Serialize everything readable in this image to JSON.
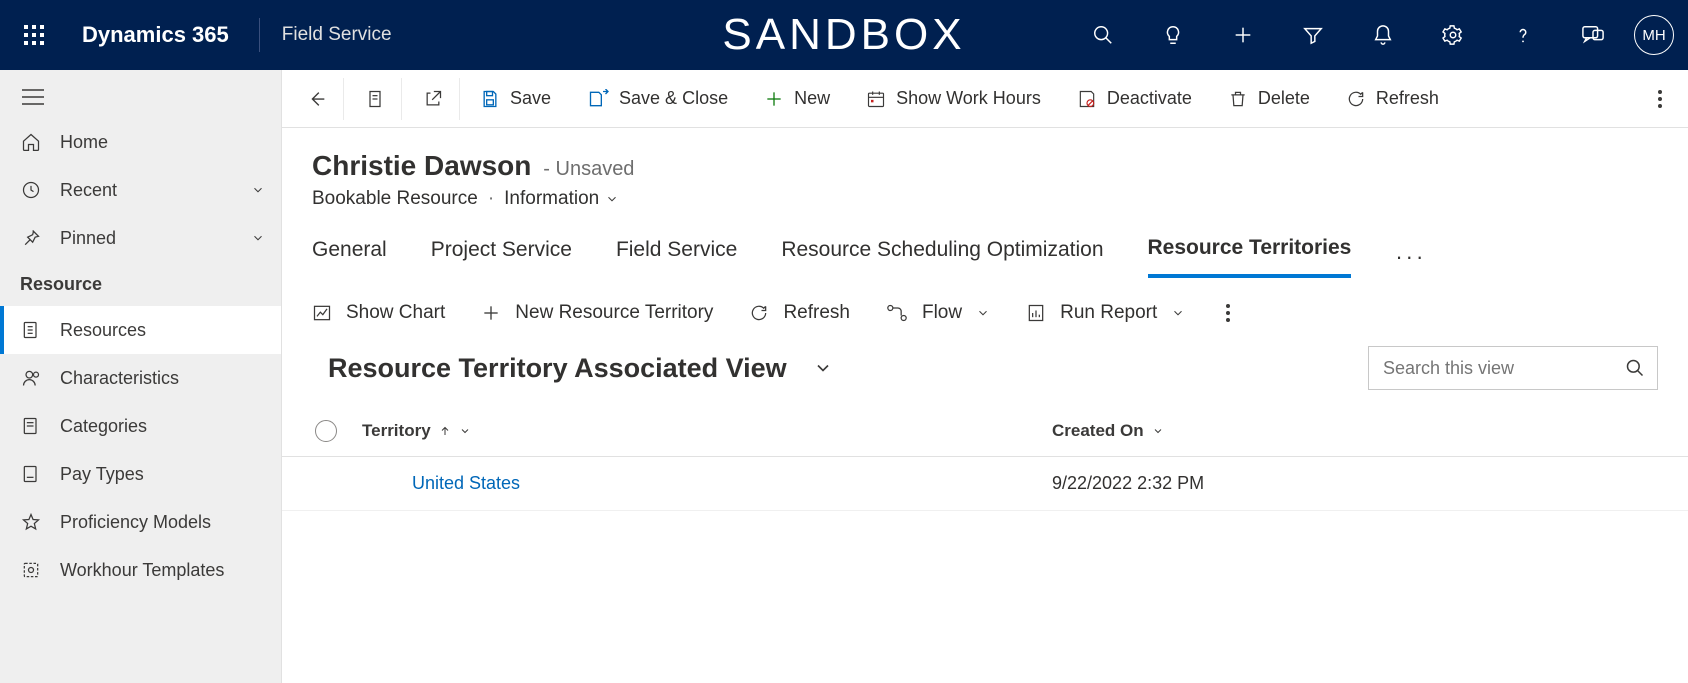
{
  "navbar": {
    "app": "Dynamics 365",
    "area": "Field Service",
    "sandbox": "SANDBOX",
    "avatar": "MH"
  },
  "sidebar": {
    "home": "Home",
    "recent": "Recent",
    "pinned": "Pinned",
    "group": "Resource",
    "items": [
      {
        "label": "Resources"
      },
      {
        "label": "Characteristics"
      },
      {
        "label": "Categories"
      },
      {
        "label": "Pay Types"
      },
      {
        "label": "Proficiency Models"
      },
      {
        "label": "Workhour Templates"
      }
    ]
  },
  "toolbar": {
    "save": "Save",
    "save_close": "Save & Close",
    "new": "New",
    "work_hours": "Show Work Hours",
    "deactivate": "Deactivate",
    "delete": "Delete",
    "refresh": "Refresh"
  },
  "header": {
    "title": "Christie Dawson",
    "unsaved": "- Unsaved",
    "entity": "Bookable Resource",
    "form": "Information"
  },
  "tabs": {
    "items": [
      {
        "label": "General"
      },
      {
        "label": "Project Service"
      },
      {
        "label": "Field Service"
      },
      {
        "label": "Resource Scheduling Optimization"
      },
      {
        "label": "Resource Territories"
      }
    ],
    "selected_index": 4
  },
  "sub_toolbar": {
    "show_chart": "Show Chart",
    "new_territory": "New Resource Territory",
    "refresh": "Refresh",
    "flow": "Flow",
    "report": "Run Report"
  },
  "view": {
    "title": "Resource Territory Associated View",
    "search_placeholder": "Search this view"
  },
  "grid": {
    "col_territory": "Territory",
    "col_created": "Created On",
    "rows": [
      {
        "territory": "United States",
        "created_on": "9/22/2022 2:32 PM"
      }
    ]
  }
}
